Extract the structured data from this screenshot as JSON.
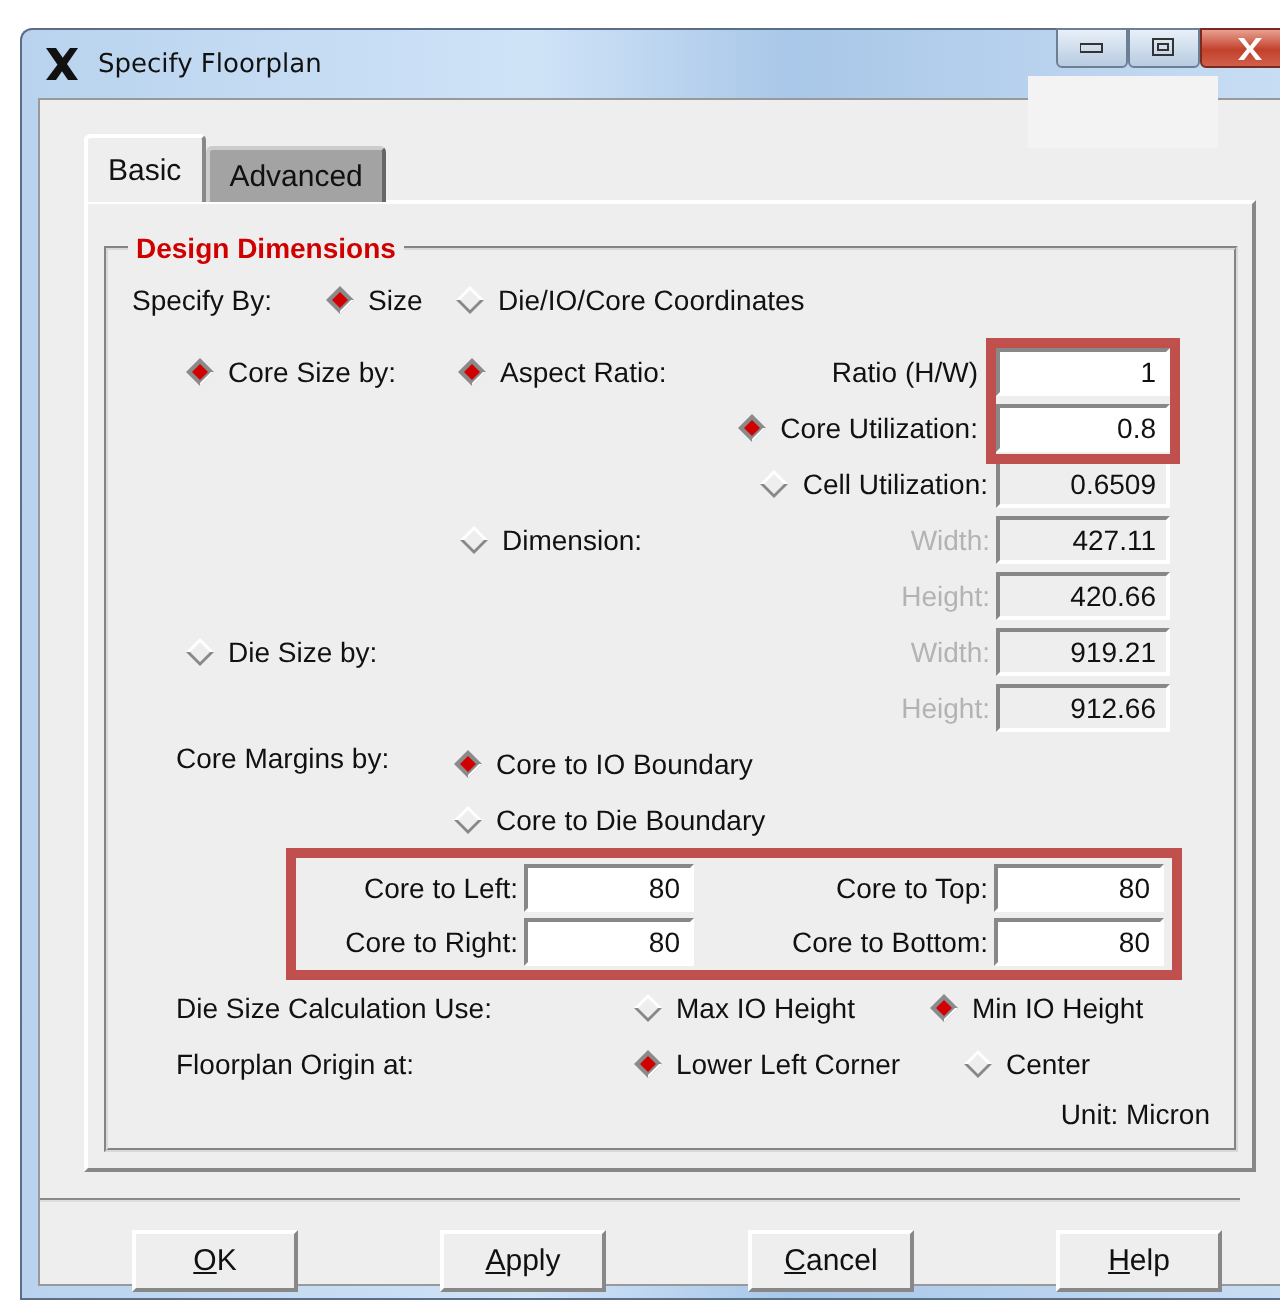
{
  "window": {
    "title": "Specify Floorplan"
  },
  "tabs": [
    {
      "label": "Basic",
      "selected": true
    },
    {
      "label": "Advanced",
      "selected": false
    }
  ],
  "group": {
    "title": "Design Dimensions"
  },
  "specify_by": {
    "label": "Specify By:",
    "options": [
      {
        "label": "Size",
        "selected": true
      },
      {
        "label": "Die/IO/Core Coordinates",
        "selected": false
      }
    ]
  },
  "core_size_by": {
    "label": "Core Size by:",
    "selected": true
  },
  "aspect_ratio": {
    "label": "Aspect Ratio:",
    "selected": true,
    "field": {
      "label": "Ratio (H/W)",
      "value": "1",
      "editable": true,
      "disabled": false
    }
  },
  "core_utilization": {
    "label": "Core Utilization:",
    "selected": true,
    "field": {
      "value": "0.8",
      "editable": true
    }
  },
  "cell_utilization": {
    "label": "Cell Utilization:",
    "selected": false,
    "field": {
      "value": "0.6509",
      "editable": false
    }
  },
  "dimension": {
    "label": "Dimension:",
    "selected": false,
    "fields": [
      {
        "label": "Width:",
        "value": "427.11",
        "editable": false,
        "disabled": true
      },
      {
        "label": "Height:",
        "value": "420.66",
        "editable": false,
        "disabled": true
      }
    ]
  },
  "die_size_by": {
    "label": "Die Size by:",
    "selected": false,
    "fields": [
      {
        "label": "Width:",
        "value": "919.21",
        "editable": false,
        "disabled": true
      },
      {
        "label": "Height:",
        "value": "912.66",
        "editable": false,
        "disabled": true
      }
    ]
  },
  "core_margins": {
    "label": "Core Margins by:",
    "options": [
      {
        "label": "Core to IO Boundary",
        "selected": true
      },
      {
        "label": "Core to Die Boundary",
        "selected": false
      }
    ],
    "fields": [
      {
        "label": "Core to Left:",
        "value": "80"
      },
      {
        "label": "Core to Top:",
        "value": "80"
      },
      {
        "label": "Core to Right:",
        "value": "80"
      },
      {
        "label": "Core to Bottom:",
        "value": "80"
      }
    ]
  },
  "die_size_calculation": {
    "label": "Die Size Calculation Use:",
    "options": [
      {
        "label": "Max IO Height",
        "selected": false
      },
      {
        "label": "Min IO Height",
        "selected": true
      }
    ]
  },
  "floorplan_origin": {
    "label": "Floorplan Origin at:",
    "options": [
      {
        "label": "Lower Left Corner",
        "selected": true
      },
      {
        "label": "Center",
        "selected": false
      }
    ]
  },
  "unit": "Unit: Micron",
  "buttons": [
    {
      "label": "OK"
    },
    {
      "label": "Apply"
    },
    {
      "label": "Cancel"
    },
    {
      "label": "Help"
    }
  ]
}
